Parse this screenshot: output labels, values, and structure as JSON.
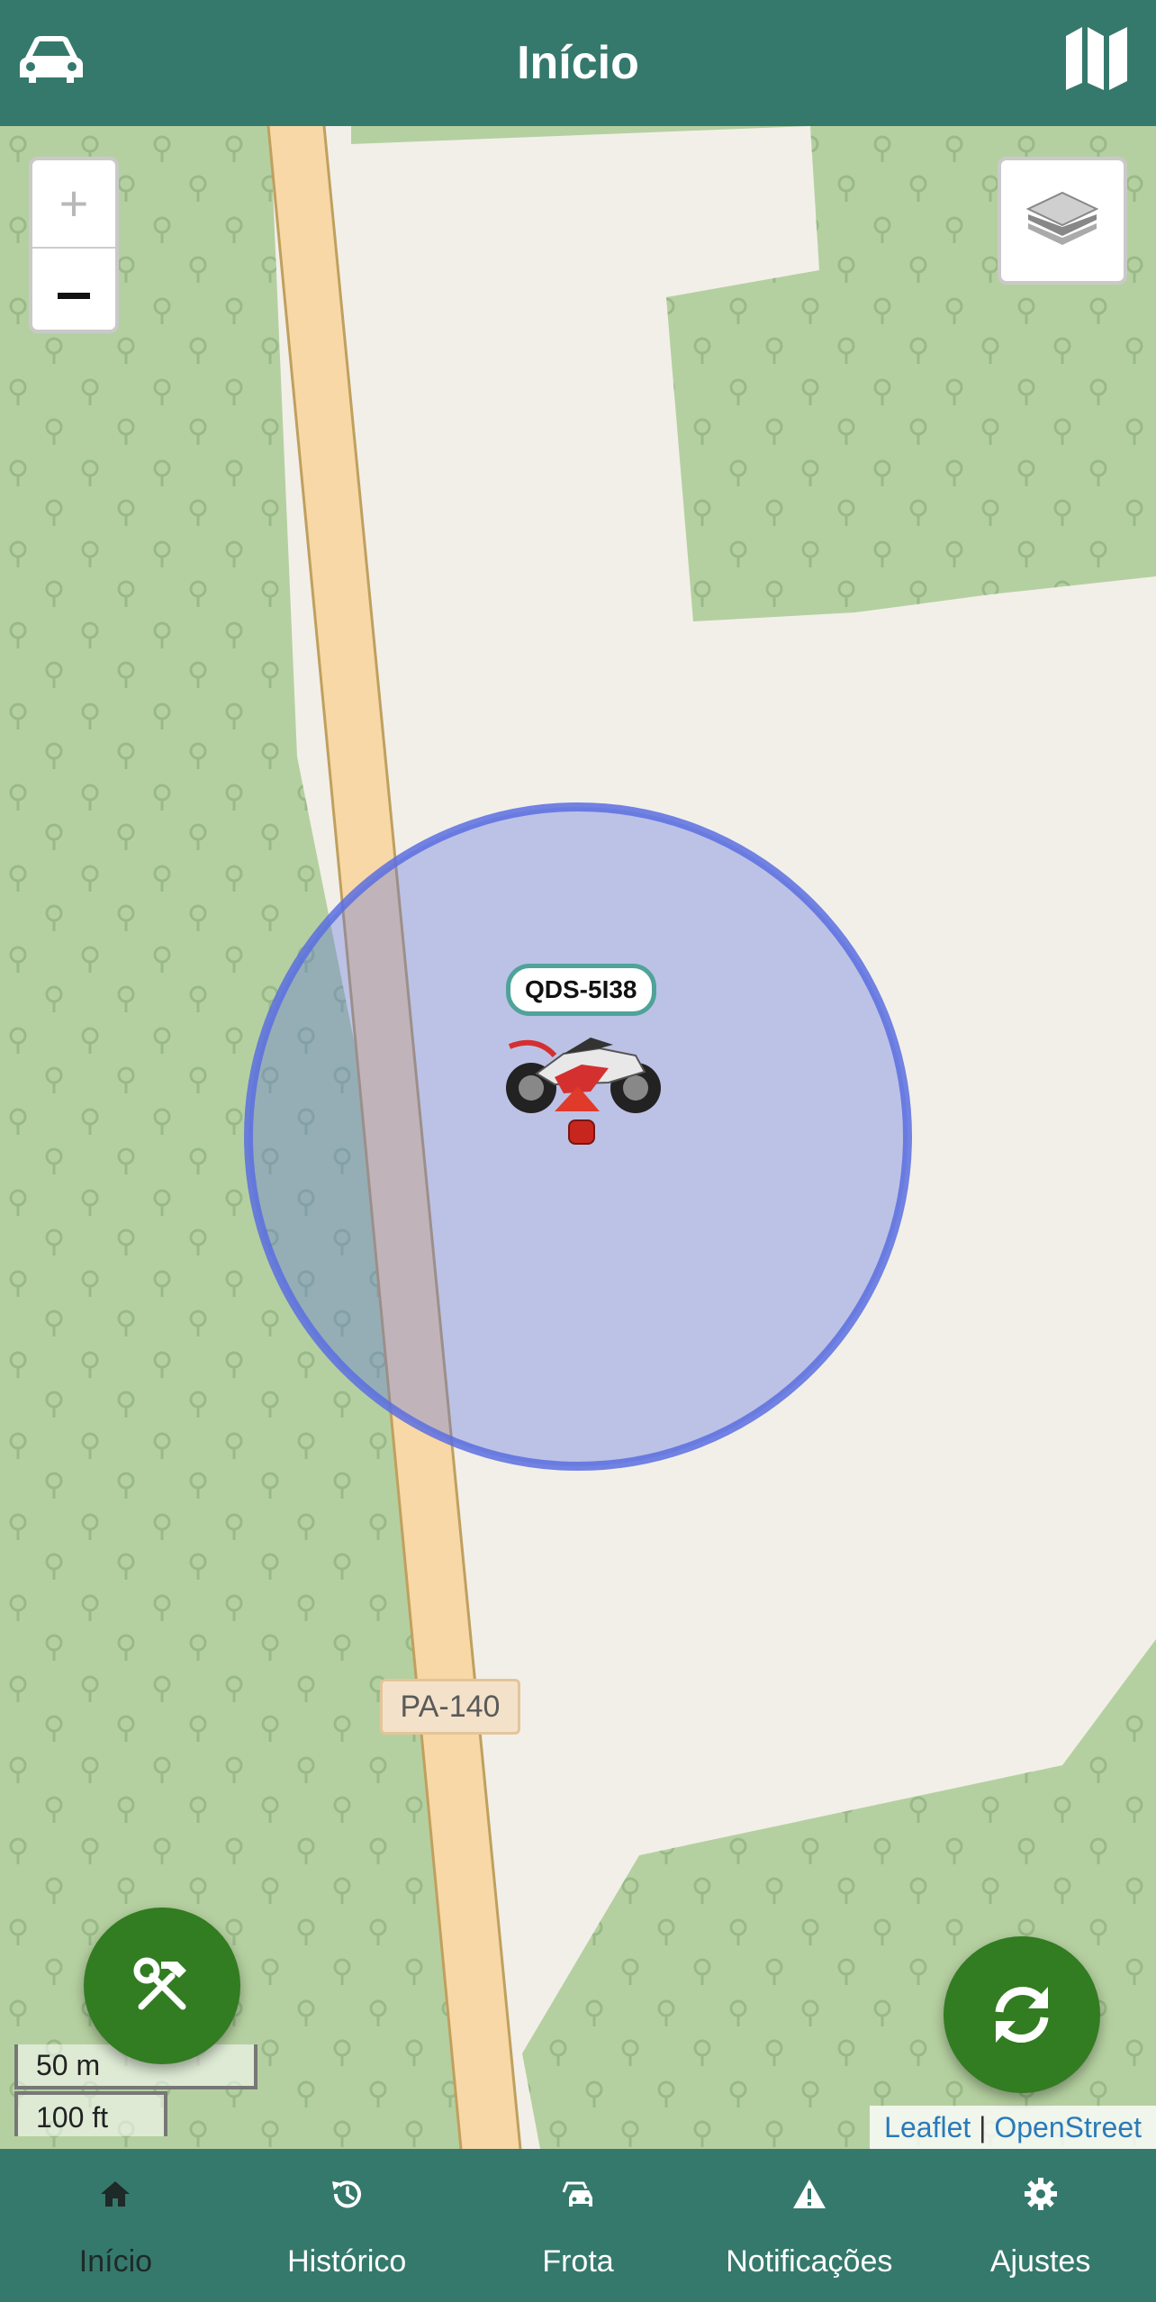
{
  "header": {
    "title": "Início",
    "left_icon": "car-icon",
    "right_icon": "map-icon"
  },
  "map": {
    "zoom_in_label": "+",
    "layers_icon": "layers-icon",
    "vehicle": {
      "plate": "QDS-5I38",
      "icon": "motorcycle-icon"
    },
    "road_label": "PA-140",
    "scale": {
      "metric": "50 m",
      "imperial": "100 ft"
    },
    "attribution": {
      "leaflet": "Leaflet",
      "separator": "|",
      "osm": "OpenStreet"
    },
    "colors": {
      "forest": "#b5d0a0",
      "ground": "#f2efe9",
      "road": "#f7d8a6",
      "accuracy_circle": "#5a6fe0"
    }
  },
  "fabs": {
    "tools_icon": "tools-icon",
    "refresh_icon": "refresh-icon",
    "color": "#327c22"
  },
  "nav": {
    "items": [
      {
        "label": "Início",
        "icon": "home-icon",
        "active": true
      },
      {
        "label": "Histórico",
        "icon": "history-icon",
        "active": false
      },
      {
        "label": "Frota",
        "icon": "fleet-icon",
        "active": false
      },
      {
        "label": "Notificações",
        "icon": "warning-icon",
        "active": false
      },
      {
        "label": "Ajustes",
        "icon": "gear-icon",
        "active": false
      }
    ]
  },
  "theme": {
    "primary": "#35796c",
    "active_label": "#1d2a27"
  }
}
